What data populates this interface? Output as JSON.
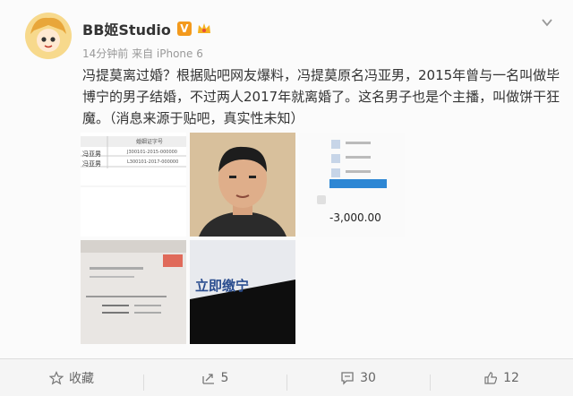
{
  "post": {
    "user_name": "BB姬Studio",
    "verified_badge": "V",
    "meta": "14分钟前 来自 iPhone 6",
    "text": "冯提莫离过婚？根据贴吧网友爆料，冯提莫原名冯亚男，2015年曾与一名叫做毕博宁的男子结婚，不过两人2017年就离婚了。这名男子也是个主播，叫做饼干狂魔。（消息来源于贴吧，真实性未知）"
  },
  "images": {
    "amount": "-3,000.00",
    "doc_header": "婚姻证字号",
    "doc_name1": "冯亚男",
    "doc_name2": "冯亚男",
    "doc_code1": "J300101-2015-000000",
    "doc_code2": "L300101-2017-000000",
    "ticket_text": "立即缴宁"
  },
  "actions": {
    "favorite": "收藏",
    "repost": "5",
    "comment": "30",
    "like": "12"
  },
  "colors": {
    "badge": "#f39a1d",
    "background": "#fbfbfb"
  }
}
